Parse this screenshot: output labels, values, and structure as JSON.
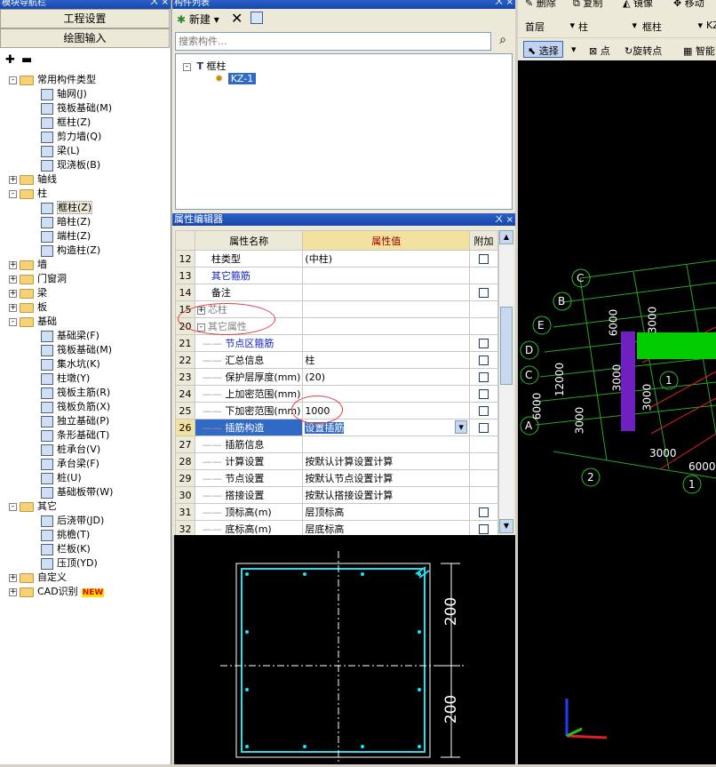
{
  "nav": {
    "title": "模块导航栏",
    "btn_project": "工程设置",
    "btn_draw": "绘图输入",
    "tree": [
      {
        "label": "常用构件类型",
        "level": 0,
        "expand": "-"
      },
      {
        "label": "轴网(J)",
        "level": 1
      },
      {
        "label": "筏板基础(M)",
        "level": 1
      },
      {
        "label": "框柱(Z)",
        "level": 1
      },
      {
        "label": "剪力墙(Q)",
        "level": 1
      },
      {
        "label": "梁(L)",
        "level": 1
      },
      {
        "label": "现浇板(B)",
        "level": 1
      },
      {
        "label": "轴线",
        "level": 0,
        "expand": "+"
      },
      {
        "label": "柱",
        "level": 0,
        "expand": "-"
      },
      {
        "label": "框柱(Z)",
        "level": 1,
        "selected": true
      },
      {
        "label": "暗柱(Z)",
        "level": 1
      },
      {
        "label": "端柱(Z)",
        "level": 1
      },
      {
        "label": "构造柱(Z)",
        "level": 1
      },
      {
        "label": "墙",
        "level": 0,
        "expand": "+"
      },
      {
        "label": "门窗洞",
        "level": 0,
        "expand": "+"
      },
      {
        "label": "梁",
        "level": 0,
        "expand": "+"
      },
      {
        "label": "板",
        "level": 0,
        "expand": "+"
      },
      {
        "label": "基础",
        "level": 0,
        "expand": "-"
      },
      {
        "label": "基础梁(F)",
        "level": 1
      },
      {
        "label": "筏板基础(M)",
        "level": 1
      },
      {
        "label": "集水坑(K)",
        "level": 1
      },
      {
        "label": "柱墩(Y)",
        "level": 1
      },
      {
        "label": "筏板主筋(R)",
        "level": 1
      },
      {
        "label": "筏板负筋(X)",
        "level": 1
      },
      {
        "label": "独立基础(P)",
        "level": 1
      },
      {
        "label": "条形基础(T)",
        "level": 1
      },
      {
        "label": "桩承台(V)",
        "level": 1
      },
      {
        "label": "承台梁(F)",
        "level": 1
      },
      {
        "label": "桩(U)",
        "level": 1
      },
      {
        "label": "基础板带(W)",
        "level": 1
      },
      {
        "label": "其它",
        "level": 0,
        "expand": "-"
      },
      {
        "label": "后浇带(JD)",
        "level": 1
      },
      {
        "label": "挑檐(T)",
        "level": 1
      },
      {
        "label": "栏板(K)",
        "level": 1
      },
      {
        "label": "压顶(YD)",
        "level": 1
      },
      {
        "label": "自定义",
        "level": 0,
        "expand": "+"
      },
      {
        "label": "CAD识别",
        "level": 0,
        "expand": "+",
        "badge": "NEW"
      }
    ]
  },
  "component_list": {
    "title": "构件列表",
    "new_label": "新建",
    "search_placeholder": "搜索构件...",
    "root": "框柱",
    "child": "KZ-1"
  },
  "property_editor": {
    "title": "属性编辑器",
    "col_name": "属性名称",
    "col_value": "属性值",
    "col_extra": "附加",
    "rows": [
      {
        "no": "12",
        "name": "柱类型",
        "value": "(中柱)",
        "check": true,
        "style": ""
      },
      {
        "no": "13",
        "name": "其它箍筋",
        "value": "",
        "check": false,
        "style": "blue"
      },
      {
        "no": "14",
        "name": "备注",
        "value": "",
        "check": true,
        "style": ""
      },
      {
        "no": "15",
        "name": "芯柱",
        "value": "",
        "check": false,
        "style": "grey",
        "expand": "+"
      },
      {
        "no": "20",
        "name": "其它属性",
        "value": "",
        "check": false,
        "style": "grey",
        "expand": "-"
      },
      {
        "no": "21",
        "name": "节点区箍筋",
        "value": "",
        "check": true,
        "style": "blue",
        "indent": true
      },
      {
        "no": "22",
        "name": "汇总信息",
        "value": "柱",
        "check": true,
        "style": "",
        "indent": true
      },
      {
        "no": "23",
        "name": "保护层厚度(mm)",
        "value": "(20)",
        "check": true,
        "style": "",
        "indent": true
      },
      {
        "no": "24",
        "name": "上加密范围(mm)",
        "value": "",
        "check": true,
        "style": "",
        "indent": true
      },
      {
        "no": "25",
        "name": "下加密范围(mm)",
        "value": "1000",
        "check": true,
        "style": "",
        "indent": true
      },
      {
        "no": "26",
        "name": "插筋构造",
        "value": "设置插筋",
        "check": true,
        "style": "selected",
        "indent": true
      },
      {
        "no": "27",
        "name": "插筋信息",
        "value": "",
        "check": false,
        "style": "",
        "indent": true
      },
      {
        "no": "28",
        "name": "计算设置",
        "value": "按默认计算设置计算",
        "check": false,
        "style": "",
        "indent": true
      },
      {
        "no": "29",
        "name": "节点设置",
        "value": "按默认节点设置计算",
        "check": false,
        "style": "",
        "indent": true
      },
      {
        "no": "30",
        "name": "搭接设置",
        "value": "按默认搭接设置计算",
        "check": false,
        "style": "",
        "indent": true
      },
      {
        "no": "31",
        "name": "顶标高(m)",
        "value": "层顶标高",
        "check": true,
        "style": "",
        "indent": true
      },
      {
        "no": "32",
        "name": "底标高(m)",
        "value": "层底标高",
        "check": true,
        "style": "",
        "indent": true
      }
    ]
  },
  "section": {
    "dim_top": "200",
    "dim_bottom": "200"
  },
  "toolbar": {
    "delete": "删除",
    "copy": "复制",
    "mirror": "镜像",
    "move": "移动",
    "floor": "首层",
    "type": "柱",
    "subtype": "框柱",
    "name": "KZ",
    "select": "选择",
    "point": "点",
    "rotate_point": "旋转点",
    "smart": "智能"
  },
  "viewport": {
    "axis_labels": [
      "C",
      "B",
      "E",
      "D",
      "C",
      "A",
      "1",
      "2",
      "1"
    ],
    "dims": [
      "6000",
      "3000",
      "12000",
      "3000",
      "6000",
      "3000",
      "3000",
      "3000",
      "6000"
    ],
    "axis_colors": {
      "x": "#e02020",
      "y": "#20c020",
      "z": "#2040ff"
    }
  }
}
